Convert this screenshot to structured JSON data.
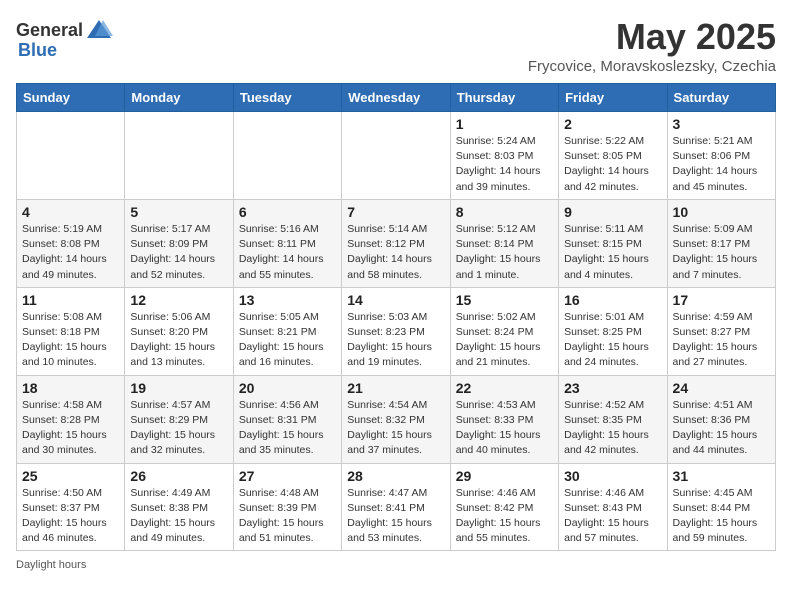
{
  "header": {
    "logo_general": "General",
    "logo_blue": "Blue",
    "title": "May 2025",
    "location": "Frycovice, Moravskoslezsky, Czechia"
  },
  "days_of_week": [
    "Sunday",
    "Monday",
    "Tuesday",
    "Wednesday",
    "Thursday",
    "Friday",
    "Saturday"
  ],
  "weeks": [
    [
      {
        "day": "",
        "info": ""
      },
      {
        "day": "",
        "info": ""
      },
      {
        "day": "",
        "info": ""
      },
      {
        "day": "",
        "info": ""
      },
      {
        "day": "1",
        "info": "Sunrise: 5:24 AM\nSunset: 8:03 PM\nDaylight: 14 hours\nand 39 minutes."
      },
      {
        "day": "2",
        "info": "Sunrise: 5:22 AM\nSunset: 8:05 PM\nDaylight: 14 hours\nand 42 minutes."
      },
      {
        "day": "3",
        "info": "Sunrise: 5:21 AM\nSunset: 8:06 PM\nDaylight: 14 hours\nand 45 minutes."
      }
    ],
    [
      {
        "day": "4",
        "info": "Sunrise: 5:19 AM\nSunset: 8:08 PM\nDaylight: 14 hours\nand 49 minutes."
      },
      {
        "day": "5",
        "info": "Sunrise: 5:17 AM\nSunset: 8:09 PM\nDaylight: 14 hours\nand 52 minutes."
      },
      {
        "day": "6",
        "info": "Sunrise: 5:16 AM\nSunset: 8:11 PM\nDaylight: 14 hours\nand 55 minutes."
      },
      {
        "day": "7",
        "info": "Sunrise: 5:14 AM\nSunset: 8:12 PM\nDaylight: 14 hours\nand 58 minutes."
      },
      {
        "day": "8",
        "info": "Sunrise: 5:12 AM\nSunset: 8:14 PM\nDaylight: 15 hours\nand 1 minute."
      },
      {
        "day": "9",
        "info": "Sunrise: 5:11 AM\nSunset: 8:15 PM\nDaylight: 15 hours\nand 4 minutes."
      },
      {
        "day": "10",
        "info": "Sunrise: 5:09 AM\nSunset: 8:17 PM\nDaylight: 15 hours\nand 7 minutes."
      }
    ],
    [
      {
        "day": "11",
        "info": "Sunrise: 5:08 AM\nSunset: 8:18 PM\nDaylight: 15 hours\nand 10 minutes."
      },
      {
        "day": "12",
        "info": "Sunrise: 5:06 AM\nSunset: 8:20 PM\nDaylight: 15 hours\nand 13 minutes."
      },
      {
        "day": "13",
        "info": "Sunrise: 5:05 AM\nSunset: 8:21 PM\nDaylight: 15 hours\nand 16 minutes."
      },
      {
        "day": "14",
        "info": "Sunrise: 5:03 AM\nSunset: 8:23 PM\nDaylight: 15 hours\nand 19 minutes."
      },
      {
        "day": "15",
        "info": "Sunrise: 5:02 AM\nSunset: 8:24 PM\nDaylight: 15 hours\nand 21 minutes."
      },
      {
        "day": "16",
        "info": "Sunrise: 5:01 AM\nSunset: 8:25 PM\nDaylight: 15 hours\nand 24 minutes."
      },
      {
        "day": "17",
        "info": "Sunrise: 4:59 AM\nSunset: 8:27 PM\nDaylight: 15 hours\nand 27 minutes."
      }
    ],
    [
      {
        "day": "18",
        "info": "Sunrise: 4:58 AM\nSunset: 8:28 PM\nDaylight: 15 hours\nand 30 minutes."
      },
      {
        "day": "19",
        "info": "Sunrise: 4:57 AM\nSunset: 8:29 PM\nDaylight: 15 hours\nand 32 minutes."
      },
      {
        "day": "20",
        "info": "Sunrise: 4:56 AM\nSunset: 8:31 PM\nDaylight: 15 hours\nand 35 minutes."
      },
      {
        "day": "21",
        "info": "Sunrise: 4:54 AM\nSunset: 8:32 PM\nDaylight: 15 hours\nand 37 minutes."
      },
      {
        "day": "22",
        "info": "Sunrise: 4:53 AM\nSunset: 8:33 PM\nDaylight: 15 hours\nand 40 minutes."
      },
      {
        "day": "23",
        "info": "Sunrise: 4:52 AM\nSunset: 8:35 PM\nDaylight: 15 hours\nand 42 minutes."
      },
      {
        "day": "24",
        "info": "Sunrise: 4:51 AM\nSunset: 8:36 PM\nDaylight: 15 hours\nand 44 minutes."
      }
    ],
    [
      {
        "day": "25",
        "info": "Sunrise: 4:50 AM\nSunset: 8:37 PM\nDaylight: 15 hours\nand 46 minutes."
      },
      {
        "day": "26",
        "info": "Sunrise: 4:49 AM\nSunset: 8:38 PM\nDaylight: 15 hours\nand 49 minutes."
      },
      {
        "day": "27",
        "info": "Sunrise: 4:48 AM\nSunset: 8:39 PM\nDaylight: 15 hours\nand 51 minutes."
      },
      {
        "day": "28",
        "info": "Sunrise: 4:47 AM\nSunset: 8:41 PM\nDaylight: 15 hours\nand 53 minutes."
      },
      {
        "day": "29",
        "info": "Sunrise: 4:46 AM\nSunset: 8:42 PM\nDaylight: 15 hours\nand 55 minutes."
      },
      {
        "day": "30",
        "info": "Sunrise: 4:46 AM\nSunset: 8:43 PM\nDaylight: 15 hours\nand 57 minutes."
      },
      {
        "day": "31",
        "info": "Sunrise: 4:45 AM\nSunset: 8:44 PM\nDaylight: 15 hours\nand 59 minutes."
      }
    ]
  ],
  "footer": {
    "daylight_label": "Daylight hours"
  }
}
